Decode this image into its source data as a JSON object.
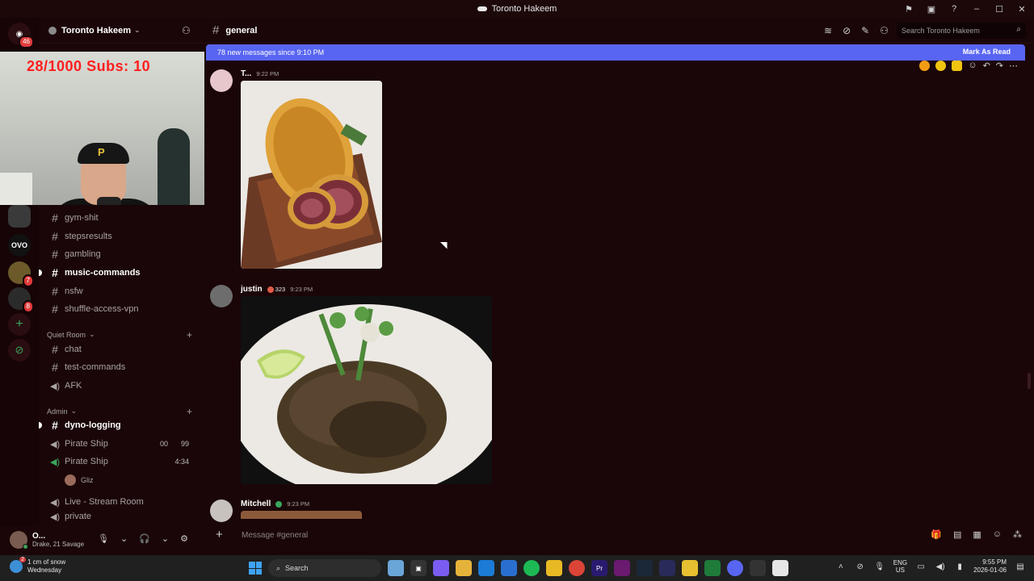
{
  "window": {
    "title": "Toronto Hakeem"
  },
  "server": {
    "name": "Toronto Hakeem",
    "rail_badge": "46",
    "rail_badges": [
      "7",
      "8"
    ]
  },
  "stream_overlay": {
    "text": "28/1000  Subs: 10"
  },
  "channels": [
    {
      "name": "gym-shit",
      "kind": "text",
      "bold": false
    },
    {
      "name": "stepsresults",
      "kind": "text",
      "bold": false
    },
    {
      "name": "gambling",
      "kind": "text",
      "bold": false
    },
    {
      "name": "music-commands",
      "kind": "text",
      "bold": true
    },
    {
      "name": "nsfw",
      "kind": "text",
      "bold": false
    },
    {
      "name": "shuffle-access-vpn",
      "kind": "text",
      "bold": false
    }
  ],
  "categories": {
    "quiet_room": "Quiet Room",
    "admin": "Admin"
  },
  "quiet_room_channels": [
    {
      "name": "chat",
      "kind": "text"
    },
    {
      "name": "test-commands",
      "kind": "text"
    },
    {
      "name": "AFK",
      "kind": "voice"
    }
  ],
  "admin_channels": [
    {
      "name": "dyno-logging",
      "kind": "text",
      "bold": true
    },
    {
      "name": "Pirate Ship",
      "kind": "voice",
      "meta_left": "00",
      "meta_right": "99"
    },
    {
      "name": "Pirate Ship",
      "kind": "voice",
      "meta": "4:34"
    },
    {
      "name": "Gliz",
      "kind": "member"
    },
    {
      "name": "Live - Stream Room",
      "kind": "voice"
    },
    {
      "name": "private",
      "kind": "voice"
    }
  ],
  "user": {
    "name": "O...",
    "status": "Drake, 21 Savage"
  },
  "channel_header": {
    "name": "general",
    "search_placeholder": "Search Toronto Hakeem"
  },
  "new_messages": {
    "text": "78 new messages since 9:10 PM",
    "mark_read": "Mark As Read"
  },
  "messages": [
    {
      "author": "T...",
      "time": "9:22 PM",
      "tag": ""
    },
    {
      "author": "justin",
      "time": "9:23 PM",
      "tag": "323"
    },
    {
      "author": "Mitchell",
      "time": "9:23 PM",
      "tag": ""
    }
  ],
  "composer": {
    "placeholder": "Message #general"
  },
  "taskbar": {
    "weather_title": "1 cm of snow",
    "weather_day": "Wednesday",
    "weather_badge": "2",
    "search": "Search",
    "lang_top": "ENG",
    "lang_bottom": "US",
    "time": "9:55 PM",
    "date": "2026-01-06"
  },
  "colors": {
    "accent": "#5865f2",
    "background": "#1a0608",
    "online": "#3ba55c"
  }
}
